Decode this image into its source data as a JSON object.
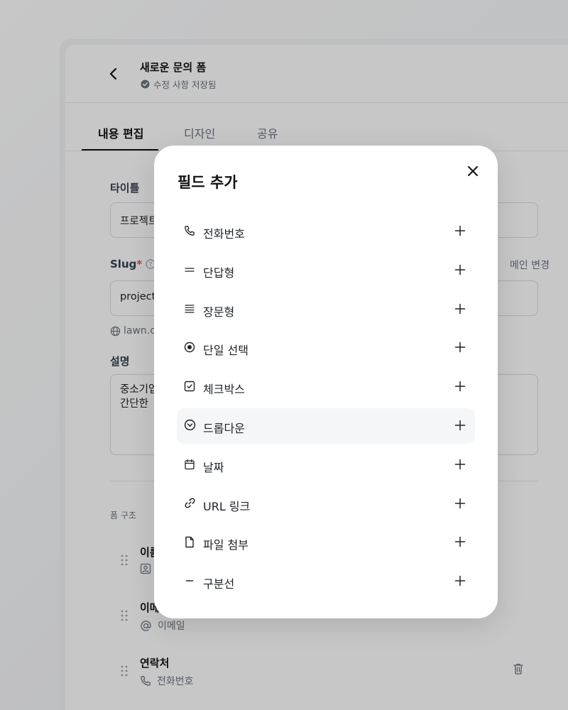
{
  "header": {
    "title": "새로운 문의 폼",
    "saved_status": "수정 사항 저장됨"
  },
  "tabs": [
    {
      "label": "내용 편집",
      "active": true
    },
    {
      "label": "디자인",
      "active": false
    },
    {
      "label": "공유",
      "active": false
    }
  ],
  "form": {
    "title_label": "타이틀",
    "title_value": "프로젝트",
    "slug_label": "Slug",
    "slug_required_mark": "*",
    "slug_value": "project",
    "domain_hint": "lawn.c",
    "domain_change": "메인 변경",
    "description_label": "설명",
    "description_line1": "중소기업",
    "description_line2": "간단한"
  },
  "structure": {
    "section_label": "폼 구조",
    "items": [
      {
        "title": "이름",
        "sub": "",
        "icon": "contact-icon"
      },
      {
        "title": "이메",
        "sub": "이메일",
        "icon": "at-icon"
      },
      {
        "title": "연락처",
        "sub": "전화번호",
        "icon": "phone-icon"
      }
    ]
  },
  "modal": {
    "title": "필드 추가",
    "fields": [
      {
        "label": "전화번호",
        "icon": "phone-icon"
      },
      {
        "label": "단답형",
        "icon": "short-text-icon"
      },
      {
        "label": "장문형",
        "icon": "long-text-icon"
      },
      {
        "label": "단일 선택",
        "icon": "radio-icon"
      },
      {
        "label": "체크박스",
        "icon": "checkbox-icon"
      },
      {
        "label": "드롭다운",
        "icon": "dropdown-icon"
      },
      {
        "label": "날짜",
        "icon": "calendar-icon"
      },
      {
        "label": "URL 링크",
        "icon": "link-icon"
      },
      {
        "label": "파일 첨부",
        "icon": "file-icon"
      },
      {
        "label": "구분선",
        "icon": "divider-icon"
      }
    ],
    "hovered_index": 5
  },
  "colors": {
    "required": "#e5484d",
    "overlay": "rgba(0,0,0,0.22)",
    "hover_row": "#f5f6f8"
  }
}
